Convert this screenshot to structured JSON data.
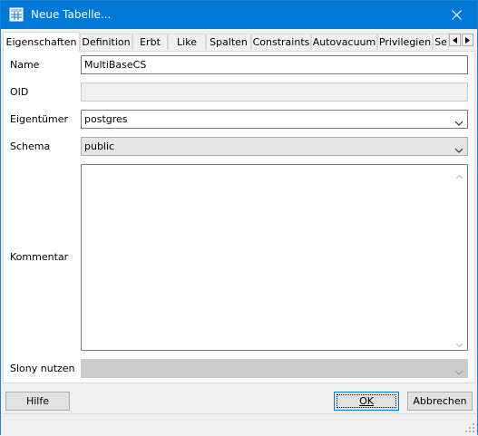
{
  "window": {
    "title": "Neue Tabelle...",
    "icon": "table-icon",
    "close_icon": "close-icon"
  },
  "tabs": [
    {
      "label": "Eigenschaften",
      "active": true
    },
    {
      "label": "Definition"
    },
    {
      "label": "Erbt"
    },
    {
      "label": "Like"
    },
    {
      "label": "Spalten"
    },
    {
      "label": "Constraints"
    },
    {
      "label": "Autovacuum"
    },
    {
      "label": "Privilegien"
    },
    {
      "label": "Se"
    }
  ],
  "tab_scroll": {
    "left_icon": "triangle-left-icon",
    "right_icon": "triangle-right-icon"
  },
  "form": {
    "name_label": "Name",
    "name_value": "MultiBaseCS",
    "oid_label": "OID",
    "oid_value": "",
    "owner_label": "Eigentümer",
    "owner_value": "postgres",
    "schema_label": "Schema",
    "schema_value": "public",
    "comment_label": "Kommentar",
    "comment_value": "",
    "slony_label": "Slony nutzen",
    "slony_value": ""
  },
  "buttons": {
    "help": "Hilfe",
    "ok": "OK",
    "cancel": "Abbrechen"
  },
  "colors": {
    "titlebar": "#0078d7",
    "panel": "#ffffff",
    "background": "#f0f0f0"
  }
}
